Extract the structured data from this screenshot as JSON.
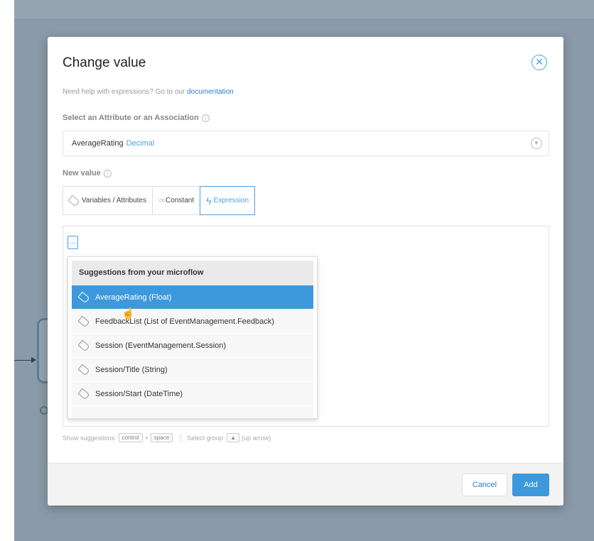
{
  "dialog": {
    "title": "Change value",
    "close_icon": "close-circle-icon",
    "help_prefix": "Need help with expressions? Go to our",
    "help_link": "documentation"
  },
  "attribute": {
    "label": "Select an Attribute or an Association",
    "value": "AverageRating",
    "type": "Decimal"
  },
  "new_value": {
    "label": "New value",
    "tabs": [
      {
        "label": "Variables / Attributes",
        "icon": "tag-icon",
        "active": false
      },
      {
        "label": "Constant",
        "icon": "circles-icon",
        "active": false
      },
      {
        "label": "Expression",
        "icon": "lightning-icon",
        "active": true
      }
    ]
  },
  "editor": {
    "button_label": "…"
  },
  "suggestions": {
    "header": "Suggestions from your microflow",
    "items": [
      {
        "label": "AverageRating (Float)",
        "selected": true
      },
      {
        "label": "FeedbackList (List of EventManagement.Feedback)",
        "selected": false
      },
      {
        "label": "Session (EventManagement.Session)",
        "selected": false
      },
      {
        "label": "Session/Title (String)",
        "selected": false
      },
      {
        "label": "Session/Start (DateTime)",
        "selected": false
      }
    ]
  },
  "hints": {
    "show_label": "Show suggestions:",
    "key1": "control",
    "plus": "+",
    "key2": "space",
    "group_label": "Select group:",
    "key3": "▲",
    "group_suffix": "(up arrow)"
  },
  "footer": {
    "cancel_label": "Cancel",
    "add_label": "Add"
  },
  "colors": {
    "accent": "#3d98dc",
    "backdrop": "#8a9aa8"
  }
}
